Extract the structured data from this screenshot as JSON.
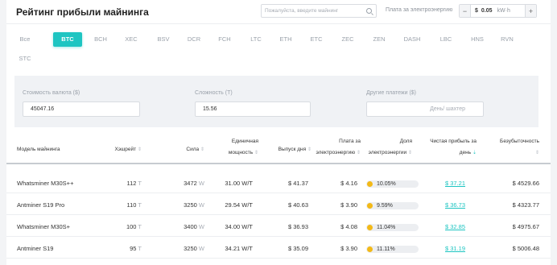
{
  "header": {
    "title": "Рейтинг прибыли майнинга",
    "search_placeholder": "Пожалуйста, введите майнинг",
    "fee_label": "Плата за электроэнергию",
    "fee_currency": "$",
    "fee_value": "0.05",
    "fee_unit": "kW·h",
    "minus": "−",
    "plus": "+"
  },
  "tabs": [
    "Все",
    "BTC",
    "BCH",
    "XEC",
    "BSV",
    "DCR",
    "FCH",
    "LTC",
    "ETH",
    "ETC",
    "ZEC",
    "ZEN",
    "DASH",
    "LBC",
    "HNS",
    "RVN",
    "STC"
  ],
  "active_tab": "BTC",
  "inputs": {
    "price_label": "Стоимость валюта ($)",
    "price_value": "45047.16",
    "difficulty_label": "Сложность (T)",
    "difficulty_value": "15.56",
    "other_label": "Другие платежи ($)",
    "other_placeholder": "День/ шахтер"
  },
  "table": {
    "columns": {
      "model": "Модель майнинга",
      "hashrate": "Хэшрейт",
      "power": "Сила",
      "unit_power_1": "Единичная",
      "unit_power_2": "мощность",
      "output": "Выпуск дня",
      "fee_1": "Плата за",
      "fee_2": "электроэнергию",
      "share_1": "Доля",
      "share_2": "электроэнергии",
      "profit_1": "Чистая прибыль за",
      "profit_2": "день",
      "breakeven": "Безубыточность"
    },
    "sort_glyph": "⇕",
    "sort_active_glyph": "⇣",
    "rows": [
      {
        "model": "Whatsminer M30S++",
        "hash": "112",
        "hash_unit": "T",
        "power": "3472",
        "power_unit": "W",
        "unit_power": "31.00 W/T",
        "output": "$ 41.37",
        "fee": "$ 4.16",
        "share": "10.05%",
        "share_value": 10.05,
        "profit": "$ 37.21",
        "breakeven": "$ 4529.66"
      },
      {
        "model": "Antminer S19 Pro",
        "hash": "110",
        "hash_unit": "T",
        "power": "3250",
        "power_unit": "W",
        "unit_power": "29.54 W/T",
        "output": "$ 40.63",
        "fee": "$ 3.90",
        "share": "9.59%",
        "share_value": 9.59,
        "profit": "$ 36.73",
        "breakeven": "$ 4323.77"
      },
      {
        "model": "Whatsminer M30S+",
        "hash": "100",
        "hash_unit": "T",
        "power": "3400",
        "power_unit": "W",
        "unit_power": "34.00 W/T",
        "output": "$ 36.93",
        "fee": "$ 4.08",
        "share": "11.04%",
        "share_value": 11.04,
        "profit": "$ 32.85",
        "breakeven": "$ 4975.67"
      },
      {
        "model": "Antminer S19",
        "hash": "95",
        "hash_unit": "T",
        "power": "3250",
        "power_unit": "W",
        "unit_power": "34.21 W/T",
        "output": "$ 35.09",
        "fee": "$ 3.90",
        "share": "11.11%",
        "share_value": 11.11,
        "profit": "$ 31.19",
        "breakeven": "$ 5006.48"
      }
    ]
  },
  "colors": {
    "accent": "#1ec5c2",
    "share_dot": "#f3b917"
  }
}
